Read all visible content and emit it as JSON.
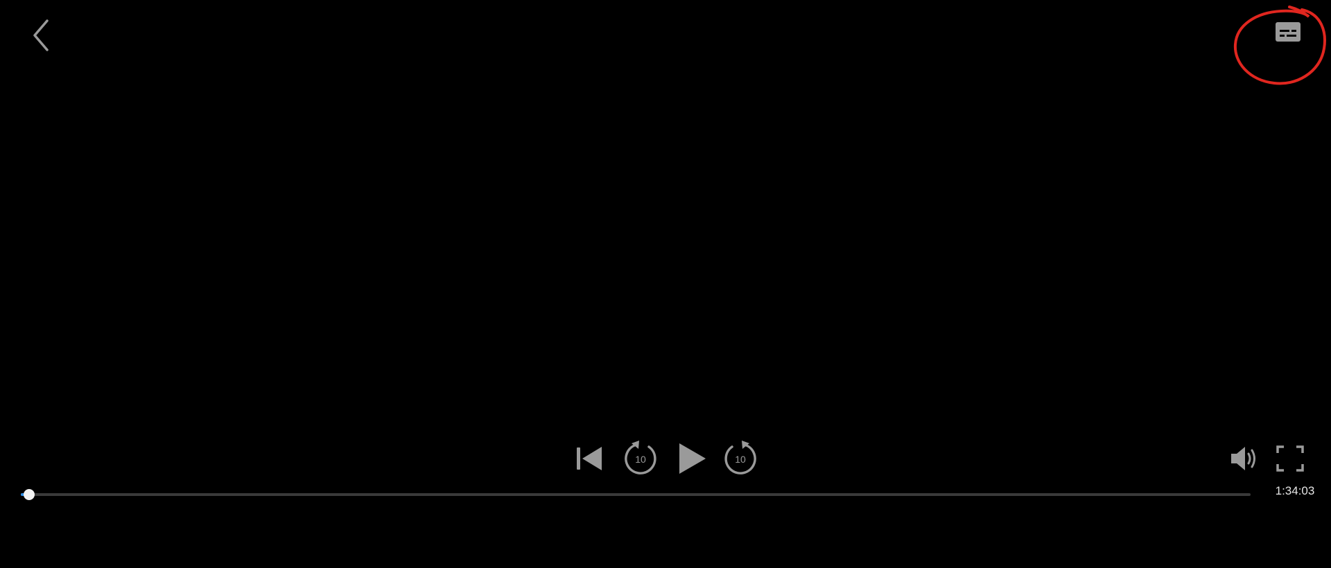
{
  "player": {
    "time_remaining": "1:34:03",
    "progress_fraction": 0.007,
    "colors": {
      "background": "#000000",
      "icon": "#9a9a9a",
      "seek_fill": "#2f8fe8",
      "seek_track": "#3a3a3a",
      "annotation": "#e0261f"
    },
    "icons": {
      "back": "chevron-left-icon",
      "subtitles": "subtitles-icon",
      "previous": "skip-previous-icon",
      "rewind": "replay-10-icon",
      "play": "play-icon",
      "forward": "forward-10-icon",
      "volume": "volume-icon",
      "fullscreen": "fullscreen-icon"
    },
    "skip_amount_label": "10"
  }
}
